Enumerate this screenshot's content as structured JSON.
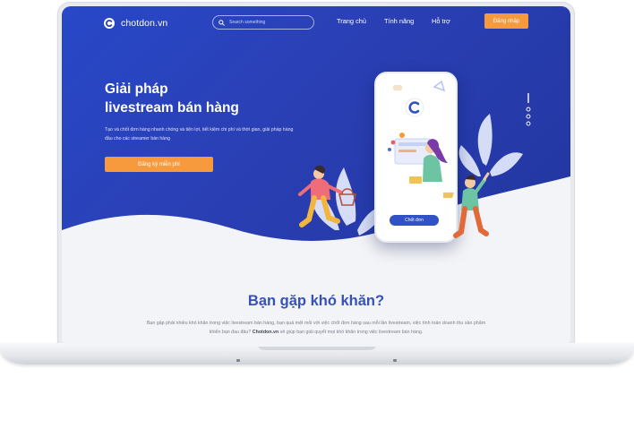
{
  "nav": {
    "logo_text": "chotdon.vn",
    "search_placeholder": "Search something",
    "links": [
      "Trang chủ",
      "Tính năng",
      "Hỗ trợ"
    ],
    "cta": "Đăng nhập"
  },
  "hero": {
    "title_line1": "Giải pháp",
    "title_line2": "livestream bán hàng",
    "description": "Tạo và chốt đơn hàng nhanh chóng và tiện lợi, tiết kiệm chi phí và thời gian, giải pháp hàng đầu cho các streamer bán hàng",
    "cta": "Đăng ký miễn phí",
    "phone_button": "Chốt đơn"
  },
  "problem": {
    "title": "Bạn gặp khó khăn?",
    "text_before": "Bạn gặp phải nhiều khó khăn trong việc livestream bán hàng, bạn quá mệt mỏi với việc chốt đơn hàng sau mỗi lần livestream, việc tính toán doanh thu sản phẩm khiến bạn đau đầu?",
    "brand": "Chotdon.vn",
    "text_after": "sẽ giúp bạn giải quyết mọi khó khăn trong việc livestream bán hàng."
  },
  "colors": {
    "hero_blue": "#2a3fb4",
    "accent_orange": "#f79a3e",
    "title_blue": "#3652b8"
  },
  "icons": [
    "logo-c-icon",
    "search-icon",
    "slider-dots-icon"
  ]
}
